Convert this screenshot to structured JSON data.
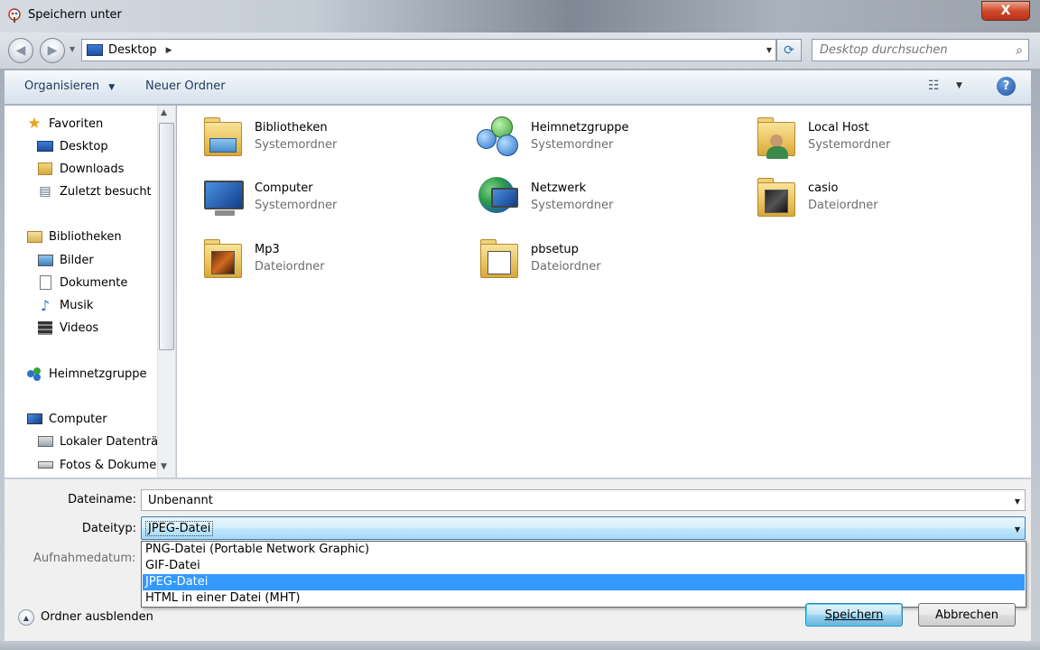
{
  "window": {
    "title": "Speichern unter",
    "close_symbol": "X"
  },
  "address": {
    "location": "Desktop",
    "search_placeholder": "Desktop durchsuchen"
  },
  "toolbar": {
    "organize_label": "Organisieren",
    "new_folder_label": "Neuer Ordner"
  },
  "nav_pane": {
    "items": [
      {
        "label": "Favoriten",
        "icon": "star-icon"
      },
      {
        "label": "Desktop",
        "icon": "desktop-icon"
      },
      {
        "label": "Downloads",
        "icon": "downloads-folder-icon"
      },
      {
        "label": "Zuletzt besucht",
        "icon": "recent-places-icon"
      },
      {
        "label": "Bibliotheken",
        "icon": "libraries-icon"
      },
      {
        "label": "Bilder",
        "icon": "pictures-icon"
      },
      {
        "label": "Dokumente",
        "icon": "documents-icon"
      },
      {
        "label": "Musik",
        "icon": "music-icon"
      },
      {
        "label": "Videos",
        "icon": "videos-icon"
      },
      {
        "label": "Heimnetzgruppe",
        "icon": "homegroup-icon"
      },
      {
        "label": "Computer",
        "icon": "computer-icon"
      },
      {
        "label": "Lokaler Datenträg",
        "icon": "local-disk-icon"
      },
      {
        "label": "Fotos & Dokume",
        "icon": "drive-icon"
      }
    ]
  },
  "content": {
    "items": [
      {
        "name": "Bibliotheken",
        "type": "Systemordner",
        "icon": "libraries-folder-icon"
      },
      {
        "name": "Heimnetzgruppe",
        "type": "Systemordner",
        "icon": "homegroup-icon"
      },
      {
        "name": "Local Host",
        "type": "Systemordner",
        "icon": "user-folder-icon"
      },
      {
        "name": "Computer",
        "type": "Systemordner",
        "icon": "computer-icon"
      },
      {
        "name": "Netzwerk",
        "type": "Systemordner",
        "icon": "network-icon"
      },
      {
        "name": "casio",
        "type": "Dateiordner",
        "icon": "folder-icon"
      },
      {
        "name": "Mp3",
        "type": "Dateiordner",
        "icon": "folder-icon"
      },
      {
        "name": "pbsetup",
        "type": "Dateiordner",
        "icon": "folder-icon"
      }
    ]
  },
  "form": {
    "filename_label": "Dateiname:",
    "filename_value": "Unbenannt",
    "filetype_label": "Dateityp:",
    "filetype_value": "JPEG-Datei",
    "date_label": "Aufnahmedatum:",
    "filetype_options": [
      "PNG-Datei (Portable Network Graphic)",
      "GIF-Datei",
      "JPEG-Datei",
      "HTML in einer Datei (MHT)"
    ],
    "selected_option_index": 2
  },
  "footer": {
    "hide_folders_label": "Ordner ausblenden",
    "save_label": "Speichern",
    "cancel_label": "Abbrechen"
  },
  "colors": {
    "selection": "#3399ff",
    "toolbar_text": "#1e395b",
    "secondary_text": "#6d6d6d"
  }
}
